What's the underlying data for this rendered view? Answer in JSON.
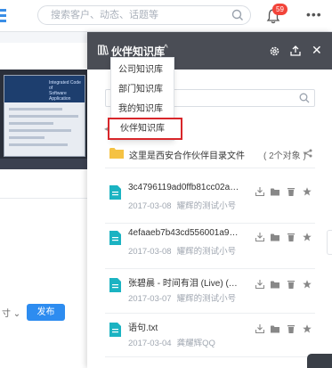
{
  "header": {
    "search_placeholder": "搜索客户、动态、话题等",
    "notification_count": "59",
    "more_label": "•••"
  },
  "left": {
    "dropdown_fragment": "寸 ⌄",
    "publish_label": "发布"
  },
  "panel": {
    "title": "伙伴知识库",
    "caret": "^",
    "close_label": "✕",
    "folder": {
      "name": "这里是西安合作伙伴目录文件",
      "count": "( 2个对象 )"
    },
    "files": [
      {
        "name": "3c4796119ad0ffb81cc02aa3a2...",
        "date": "2017-03-08",
        "author": "耀辉的测试小号"
      },
      {
        "name": "4efaaeb7b43cd556001a9a61e...",
        "date": "2017-03-08",
        "author": "耀辉的测试小号"
      },
      {
        "name": "张碧晨 - 时间有泪 (Live) (原唱：...",
        "date": "2017-03-07",
        "author": "耀辉的测试小号"
      },
      {
        "name": "语句.txt",
        "date": "2017-03-04",
        "author": "龚耀辉QQ"
      }
    ]
  },
  "menu": {
    "items": [
      "公司知识库",
      "部门知识库",
      "我的知识库",
      "伙伴知识库"
    ],
    "selected": "伙伴知识库"
  },
  "colors": {
    "panel_header": "#4a4d55",
    "accent_blue": "#2d8cf0",
    "file_icon": "#1bb3c2",
    "folder": "#f5c243",
    "badge": "#f2443a",
    "selection_outline": "#d8262a"
  }
}
